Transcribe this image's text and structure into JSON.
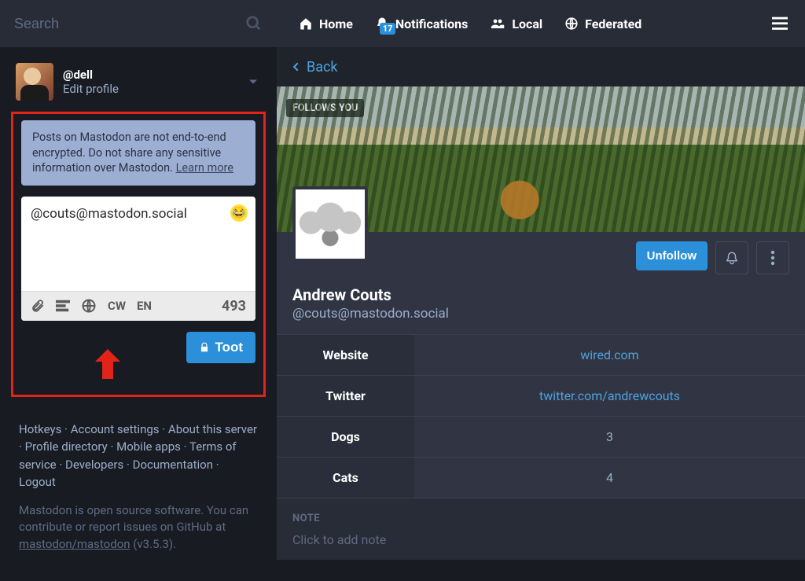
{
  "search": {
    "placeholder": "Search"
  },
  "account": {
    "handle": "@dell",
    "edit": "Edit profile"
  },
  "compose": {
    "warning_text": "Posts on Mastodon are not end-to-end encrypted. Do not share any sensitive information over Mastodon. ",
    "learn_more": "Learn more",
    "draft": "@couts@mastodon.social",
    "cw": "CW",
    "lang": "EN",
    "counter": "493",
    "toot": "Toot"
  },
  "footer": {
    "links": [
      "Hotkeys",
      "Account settings",
      "About this server",
      "Profile directory",
      "Mobile apps",
      "Terms of service",
      "Developers",
      "Documentation",
      "Logout"
    ],
    "note_a": "Mastodon is open source software. You can contribute or report issues on GitHub at ",
    "repo": "mastodon/mastodon",
    "version": " (v3.5.3)."
  },
  "nav": {
    "home": "Home",
    "notifications": "Notifications",
    "notif_badge": "17",
    "local": "Local",
    "federated": "Federated"
  },
  "back": "Back",
  "profile": {
    "follows_you": "FOLLOWS YOU",
    "display_name": "Andrew Couts",
    "handle": "@couts@mastodon.social",
    "unfollow": "Unfollow",
    "fields": [
      {
        "k": "Website",
        "v": "wired.com",
        "link": true
      },
      {
        "k": "Twitter",
        "v": "twitter.com/andrewcouts",
        "link": true
      },
      {
        "k": "Dogs",
        "v": "3",
        "link": false
      },
      {
        "k": "Cats",
        "v": "4",
        "link": false
      }
    ],
    "note_label": "NOTE",
    "note_placeholder": "Click to add note"
  }
}
